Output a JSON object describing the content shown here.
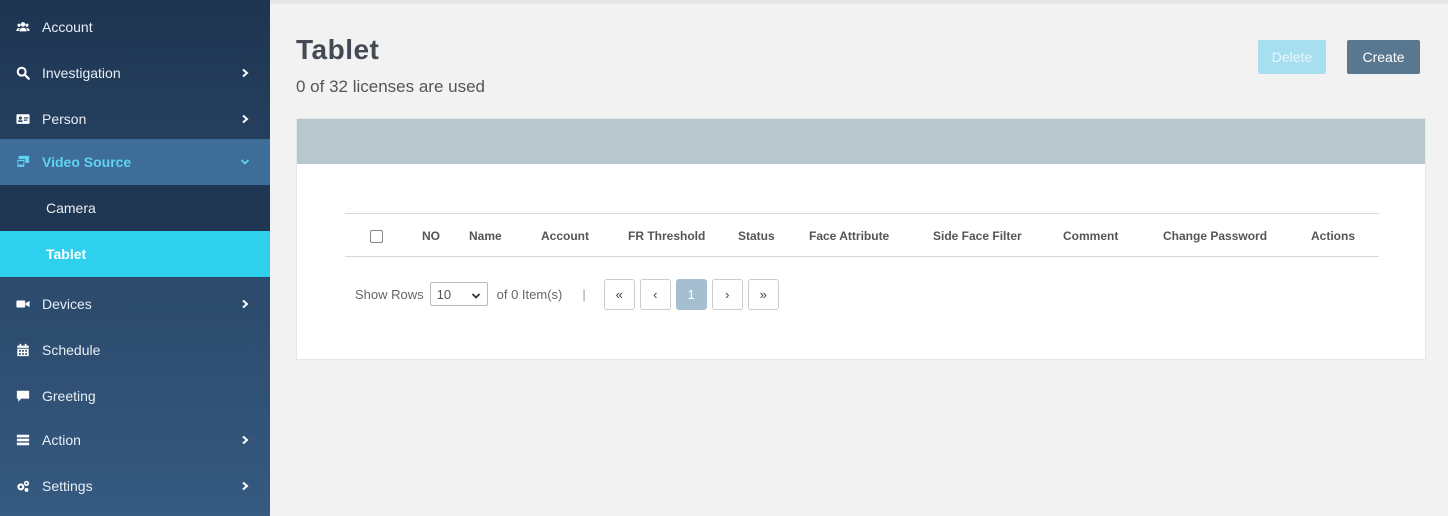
{
  "sidebar": {
    "items": [
      {
        "label": "Account",
        "icon": "users-icon"
      },
      {
        "label": "Investigation",
        "icon": "search-icon",
        "chevron": "right"
      },
      {
        "label": "Person",
        "icon": "id-card-icon",
        "chevron": "right"
      },
      {
        "label": "Video Source",
        "icon": "video-source-icon",
        "chevron": "down"
      },
      {
        "label": "Devices",
        "icon": "video-camera-icon",
        "chevron": "right"
      },
      {
        "label": "Schedule",
        "icon": "calendar-icon"
      },
      {
        "label": "Greeting",
        "icon": "comment-icon"
      },
      {
        "label": "Action",
        "icon": "list-icon",
        "chevron": "right"
      },
      {
        "label": "Settings",
        "icon": "gears-icon",
        "chevron": "right"
      }
    ],
    "sub_items": [
      {
        "label": "Camera"
      },
      {
        "label": "Tablet"
      }
    ]
  },
  "page": {
    "title": "Tablet",
    "subtitle": "0 of 32 licenses are used"
  },
  "toolbar": {
    "delete_label": "Delete",
    "create_label": "Create"
  },
  "table": {
    "columns": [
      "NO",
      "Name",
      "Account",
      "FR Threshold",
      "Status",
      "Face Attribute",
      "Side Face Filter",
      "Comment",
      "Change Password",
      "Actions"
    ],
    "rows": []
  },
  "pager": {
    "show_rows_label": "Show Rows",
    "rows_value": "10",
    "items_text": "of 0 Item(s)",
    "separator": "|",
    "first": "«",
    "prev": "‹",
    "current_page": "1",
    "next": "›",
    "last": "»"
  },
  "colors": {
    "sidebar_top": "#1e3551",
    "sidebar_bottom": "#365a80",
    "active_accent": "#2fd0ee",
    "panel_header": "#b8c7cd",
    "create_button": "#5a7790",
    "delete_button_disabled": "#a7dff1"
  }
}
